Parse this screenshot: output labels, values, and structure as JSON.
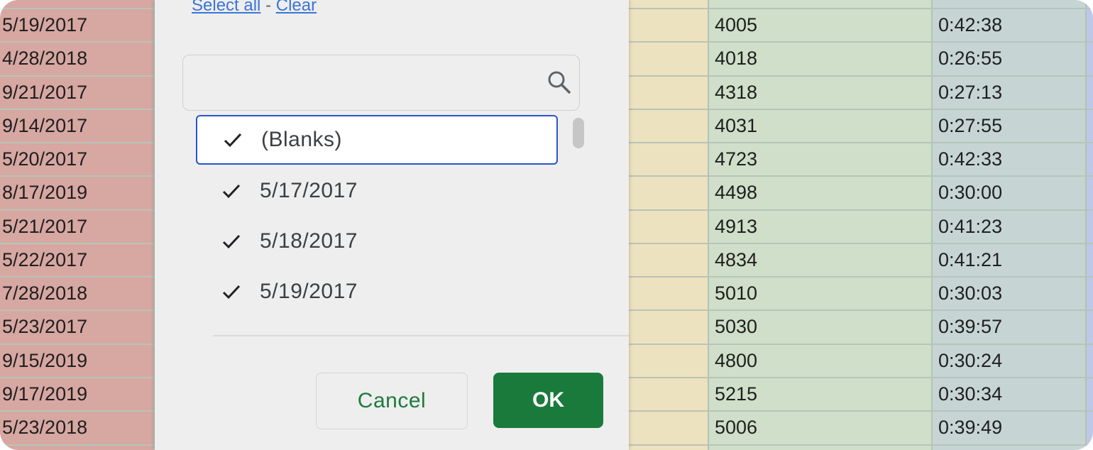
{
  "sheet": {
    "rows": [
      {
        "date": "5/19/2017",
        "number": "4005",
        "time": "0:42:38"
      },
      {
        "date": "4/28/2018",
        "number": "4018",
        "time": "0:26:55"
      },
      {
        "date": "9/21/2017",
        "number": "4318",
        "time": "0:27:13"
      },
      {
        "date": "9/14/2017",
        "number": "4031",
        "time": "0:27:55"
      },
      {
        "date": "5/20/2017",
        "number": "4723",
        "time": "0:42:33"
      },
      {
        "date": "8/17/2019",
        "number": "4498",
        "time": "0:30:00"
      },
      {
        "date": "5/21/2017",
        "number": "4913",
        "time": "0:41:23"
      },
      {
        "date": "5/22/2017",
        "number": "4834",
        "time": "0:41:21"
      },
      {
        "date": "7/28/2018",
        "number": "5010",
        "time": "0:30:03"
      },
      {
        "date": "5/23/2017",
        "number": "5030",
        "time": "0:39:57"
      },
      {
        "date": "9/15/2019",
        "number": "4800",
        "time": "0:30:24"
      },
      {
        "date": "9/17/2019",
        "number": "5215",
        "time": "0:30:34"
      },
      {
        "date": "5/23/2018",
        "number": "5006",
        "time": "0:39:49"
      }
    ]
  },
  "filter": {
    "select_all": "Select all",
    "separator": "-",
    "clear": "Clear",
    "search": {
      "value": "",
      "placeholder": ""
    },
    "items": [
      {
        "label": "(Blanks)",
        "checked": true
      },
      {
        "label": "5/17/2017",
        "checked": true
      },
      {
        "label": "5/18/2017",
        "checked": true
      },
      {
        "label": "5/19/2017",
        "checked": true
      }
    ],
    "cancel_label": "Cancel",
    "ok_label": "OK"
  },
  "colors": {
    "date_column": "#d7a7a2",
    "yellow_column": "#ede2bf",
    "number_column": "#cfdfc9",
    "time_column": "#c6d5d4",
    "ok_button": "#1a7a3c",
    "focus_border": "#2955c9",
    "link": "#3b74d9"
  }
}
